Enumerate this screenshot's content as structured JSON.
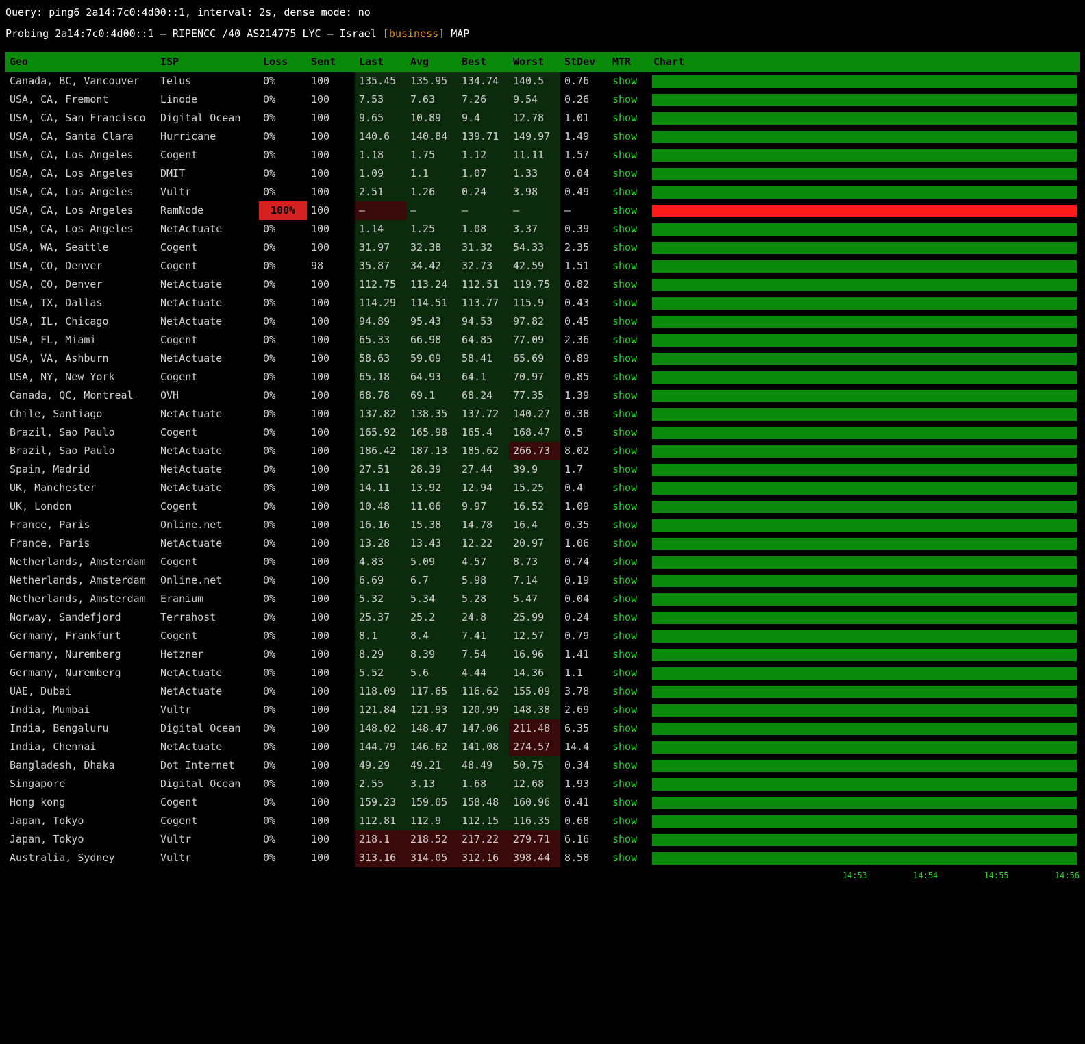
{
  "query_line": "Query: ping6 2a14:7c0:4d00::1, interval: 2s, dense mode: no",
  "probe": {
    "prefix": "Probing 2a14:7c0:4d00::1 — RIPENCC /40 ",
    "asn": "AS214775",
    "middle": " LYC — Israel ",
    "biz": "business",
    "map": "MAP"
  },
  "headers": [
    "Geo",
    "ISP",
    "Loss",
    "Sent",
    "Last",
    "Avg",
    "Best",
    "Worst",
    "StDev",
    "MTR",
    "Chart"
  ],
  "mtr_label": "show",
  "timestamps": [
    "14:53",
    "14:54",
    "14:55",
    "14:56"
  ],
  "rows": [
    {
      "geo": "Canada, BC, Vancouver",
      "isp": "Telus",
      "loss": "0%",
      "sent": "100",
      "last": "135.45",
      "avg": "135.95",
      "best": "134.74",
      "worst": "140.5",
      "stdev": "0.76",
      "bad": []
    },
    {
      "geo": "USA, CA, Fremont",
      "isp": "Linode",
      "loss": "0%",
      "sent": "100",
      "last": "7.53",
      "avg": "7.63",
      "best": "7.26",
      "worst": "9.54",
      "stdev": "0.26",
      "bad": []
    },
    {
      "geo": "USA, CA, San Francisco",
      "isp": "Digital Ocean",
      "loss": "0%",
      "sent": "100",
      "last": "9.65",
      "avg": "10.89",
      "best": "9.4",
      "worst": "12.78",
      "stdev": "1.01",
      "bad": []
    },
    {
      "geo": "USA, CA, Santa Clara",
      "isp": "Hurricane",
      "loss": "0%",
      "sent": "100",
      "last": "140.6",
      "avg": "140.84",
      "best": "139.71",
      "worst": "149.97",
      "stdev": "1.49",
      "bad": []
    },
    {
      "geo": "USA, CA, Los Angeles",
      "isp": "Cogent",
      "loss": "0%",
      "sent": "100",
      "last": "1.18",
      "avg": "1.75",
      "best": "1.12",
      "worst": "11.11",
      "stdev": "1.57",
      "bad": []
    },
    {
      "geo": "USA, CA, Los Angeles",
      "isp": "DMIT",
      "loss": "0%",
      "sent": "100",
      "last": "1.09",
      "avg": "1.1",
      "best": "1.07",
      "worst": "1.33",
      "stdev": "0.04",
      "bad": []
    },
    {
      "geo": "USA, CA, Los Angeles",
      "isp": "Vultr",
      "loss": "0%",
      "sent": "100",
      "last": "2.51",
      "avg": "1.26",
      "best": "0.24",
      "worst": "3.98",
      "stdev": "0.49",
      "bad": []
    },
    {
      "geo": "USA, CA, Los Angeles",
      "isp": "RamNode",
      "loss": "100%",
      "sent": "100",
      "last": "—",
      "avg": "—",
      "best": "—",
      "worst": "—",
      "stdev": "—",
      "fail": true,
      "bad": [
        "loss",
        "last"
      ]
    },
    {
      "geo": "USA, CA, Los Angeles",
      "isp": "NetActuate",
      "loss": "0%",
      "sent": "100",
      "last": "1.14",
      "avg": "1.25",
      "best": "1.08",
      "worst": "3.37",
      "stdev": "0.39",
      "bad": []
    },
    {
      "geo": "USA, WA, Seattle",
      "isp": "Cogent",
      "loss": "0%",
      "sent": "100",
      "last": "31.97",
      "avg": "32.38",
      "best": "31.32",
      "worst": "54.33",
      "stdev": "2.35",
      "bad": []
    },
    {
      "geo": "USA, CO, Denver",
      "isp": "Cogent",
      "loss": "0%",
      "sent": "98",
      "last": "35.87",
      "avg": "34.42",
      "best": "32.73",
      "worst": "42.59",
      "stdev": "1.51",
      "bad": []
    },
    {
      "geo": "USA, CO, Denver",
      "isp": "NetActuate",
      "loss": "0%",
      "sent": "100",
      "last": "112.75",
      "avg": "113.24",
      "best": "112.51",
      "worst": "119.75",
      "stdev": "0.82",
      "bad": []
    },
    {
      "geo": "USA, TX, Dallas",
      "isp": "NetActuate",
      "loss": "0%",
      "sent": "100",
      "last": "114.29",
      "avg": "114.51",
      "best": "113.77",
      "worst": "115.9",
      "stdev": "0.43",
      "bad": []
    },
    {
      "geo": "USA, IL, Chicago",
      "isp": "NetActuate",
      "loss": "0%",
      "sent": "100",
      "last": "94.89",
      "avg": "95.43",
      "best": "94.53",
      "worst": "97.82",
      "stdev": "0.45",
      "bad": []
    },
    {
      "geo": "USA, FL, Miami",
      "isp": "Cogent",
      "loss": "0%",
      "sent": "100",
      "last": "65.33",
      "avg": "66.98",
      "best": "64.85",
      "worst": "77.09",
      "stdev": "2.36",
      "bad": []
    },
    {
      "geo": "USA, VA, Ashburn",
      "isp": "NetActuate",
      "loss": "0%",
      "sent": "100",
      "last": "58.63",
      "avg": "59.09",
      "best": "58.41",
      "worst": "65.69",
      "stdev": "0.89",
      "bad": []
    },
    {
      "geo": "USA, NY, New York",
      "isp": "Cogent",
      "loss": "0%",
      "sent": "100",
      "last": "65.18",
      "avg": "64.93",
      "best": "64.1",
      "worst": "70.97",
      "stdev": "0.85",
      "bad": []
    },
    {
      "geo": "Canada, QC, Montreal",
      "isp": "OVH",
      "loss": "0%",
      "sent": "100",
      "last": "68.78",
      "avg": "69.1",
      "best": "68.24",
      "worst": "77.35",
      "stdev": "1.39",
      "bad": []
    },
    {
      "geo": "Chile, Santiago",
      "isp": "NetActuate",
      "loss": "0%",
      "sent": "100",
      "last": "137.82",
      "avg": "138.35",
      "best": "137.72",
      "worst": "140.27",
      "stdev": "0.38",
      "bad": []
    },
    {
      "geo": "Brazil, Sao Paulo",
      "isp": "Cogent",
      "loss": "0%",
      "sent": "100",
      "last": "165.92",
      "avg": "165.98",
      "best": "165.4",
      "worst": "168.47",
      "stdev": "0.5",
      "bad": []
    },
    {
      "geo": "Brazil, Sao Paulo",
      "isp": "NetActuate",
      "loss": "0%",
      "sent": "100",
      "last": "186.42",
      "avg": "187.13",
      "best": "185.62",
      "worst": "266.73",
      "stdev": "8.02",
      "bad": [
        "worst"
      ]
    },
    {
      "geo": "Spain, Madrid",
      "isp": "NetActuate",
      "loss": "0%",
      "sent": "100",
      "last": "27.51",
      "avg": "28.39",
      "best": "27.44",
      "worst": "39.9",
      "stdev": "1.7",
      "bad": []
    },
    {
      "geo": "UK, Manchester",
      "isp": "NetActuate",
      "loss": "0%",
      "sent": "100",
      "last": "14.11",
      "avg": "13.92",
      "best": "12.94",
      "worst": "15.25",
      "stdev": "0.4",
      "bad": []
    },
    {
      "geo": "UK, London",
      "isp": "Cogent",
      "loss": "0%",
      "sent": "100",
      "last": "10.48",
      "avg": "11.06",
      "best": "9.97",
      "worst": "16.52",
      "stdev": "1.09",
      "bad": []
    },
    {
      "geo": "France, Paris",
      "isp": "Online.net",
      "loss": "0%",
      "sent": "100",
      "last": "16.16",
      "avg": "15.38",
      "best": "14.78",
      "worst": "16.4",
      "stdev": "0.35",
      "bad": []
    },
    {
      "geo": "France, Paris",
      "isp": "NetActuate",
      "loss": "0%",
      "sent": "100",
      "last": "13.28",
      "avg": "13.43",
      "best": "12.22",
      "worst": "20.97",
      "stdev": "1.06",
      "bad": []
    },
    {
      "geo": "Netherlands, Amsterdam",
      "isp": "Cogent",
      "loss": "0%",
      "sent": "100",
      "last": "4.83",
      "avg": "5.09",
      "best": "4.57",
      "worst": "8.73",
      "stdev": "0.74",
      "bad": []
    },
    {
      "geo": "Netherlands, Amsterdam",
      "isp": "Online.net",
      "loss": "0%",
      "sent": "100",
      "last": "6.69",
      "avg": "6.7",
      "best": "5.98",
      "worst": "7.14",
      "stdev": "0.19",
      "bad": []
    },
    {
      "geo": "Netherlands, Amsterdam",
      "isp": "Eranium",
      "loss": "0%",
      "sent": "100",
      "last": "5.32",
      "avg": "5.34",
      "best": "5.28",
      "worst": "5.47",
      "stdev": "0.04",
      "bad": []
    },
    {
      "geo": "Norway, Sandefjord",
      "isp": "Terrahost",
      "loss": "0%",
      "sent": "100",
      "last": "25.37",
      "avg": "25.2",
      "best": "24.8",
      "worst": "25.99",
      "stdev": "0.24",
      "bad": []
    },
    {
      "geo": "Germany, Frankfurt",
      "isp": "Cogent",
      "loss": "0%",
      "sent": "100",
      "last": "8.1",
      "avg": "8.4",
      "best": "7.41",
      "worst": "12.57",
      "stdev": "0.79",
      "bad": []
    },
    {
      "geo": "Germany, Nuremberg",
      "isp": "Hetzner",
      "loss": "0%",
      "sent": "100",
      "last": "8.29",
      "avg": "8.39",
      "best": "7.54",
      "worst": "16.96",
      "stdev": "1.41",
      "bad": []
    },
    {
      "geo": "Germany, Nuremberg",
      "isp": "NetActuate",
      "loss": "0%",
      "sent": "100",
      "last": "5.52",
      "avg": "5.6",
      "best": "4.44",
      "worst": "14.36",
      "stdev": "1.1",
      "bad": []
    },
    {
      "geo": "UAE, Dubai",
      "isp": "NetActuate",
      "loss": "0%",
      "sent": "100",
      "last": "118.09",
      "avg": "117.65",
      "best": "116.62",
      "worst": "155.09",
      "stdev": "3.78",
      "bad": []
    },
    {
      "geo": "India, Mumbai",
      "isp": "Vultr",
      "loss": "0%",
      "sent": "100",
      "last": "121.84",
      "avg": "121.93",
      "best": "120.99",
      "worst": "148.38",
      "stdev": "2.69",
      "bad": []
    },
    {
      "geo": "India, Bengaluru",
      "isp": "Digital Ocean",
      "loss": "0%",
      "sent": "100",
      "last": "148.02",
      "avg": "148.47",
      "best": "147.06",
      "worst": "211.48",
      "stdev": "6.35",
      "bad": [
        "worst"
      ]
    },
    {
      "geo": "India, Chennai",
      "isp": "NetActuate",
      "loss": "0%",
      "sent": "100",
      "last": "144.79",
      "avg": "146.62",
      "best": "141.08",
      "worst": "274.57",
      "stdev": "14.4",
      "bad": [
        "worst"
      ]
    },
    {
      "geo": "Bangladesh, Dhaka",
      "isp": "Dot Internet",
      "loss": "0%",
      "sent": "100",
      "last": "49.29",
      "avg": "49.21",
      "best": "48.49",
      "worst": "50.75",
      "stdev": "0.34",
      "bad": []
    },
    {
      "geo": "Singapore",
      "isp": "Digital Ocean",
      "loss": "0%",
      "sent": "100",
      "last": "2.55",
      "avg": "3.13",
      "best": "1.68",
      "worst": "12.68",
      "stdev": "1.93",
      "bad": []
    },
    {
      "geo": "Hong kong",
      "isp": "Cogent",
      "loss": "0%",
      "sent": "100",
      "last": "159.23",
      "avg": "159.05",
      "best": "158.48",
      "worst": "160.96",
      "stdev": "0.41",
      "bad": []
    },
    {
      "geo": "Japan, Tokyo",
      "isp": "Cogent",
      "loss": "0%",
      "sent": "100",
      "last": "112.81",
      "avg": "112.9",
      "best": "112.15",
      "worst": "116.35",
      "stdev": "0.68",
      "bad": []
    },
    {
      "geo": "Japan, Tokyo",
      "isp": "Vultr",
      "loss": "0%",
      "sent": "100",
      "last": "218.1",
      "avg": "218.52",
      "best": "217.22",
      "worst": "279.71",
      "stdev": "6.16",
      "bad": [
        "last",
        "avg",
        "best",
        "worst"
      ]
    },
    {
      "geo": "Australia, Sydney",
      "isp": "Vultr",
      "loss": "0%",
      "sent": "100",
      "last": "313.16",
      "avg": "314.05",
      "best": "312.16",
      "worst": "398.44",
      "stdev": "8.58",
      "bad": [
        "last",
        "avg",
        "best",
        "worst"
      ]
    }
  ]
}
